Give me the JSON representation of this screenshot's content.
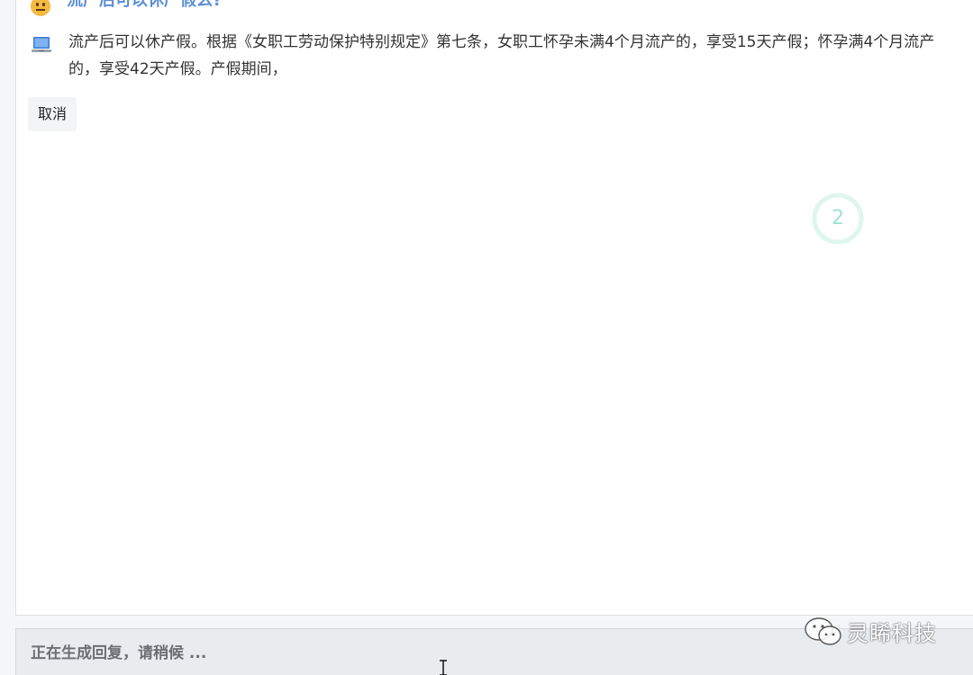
{
  "conversation": {
    "user_question": "流产后可以休产假么?",
    "bot_answer": "流产后可以休产假。根据《女职工劳动保护特别规定》第七条，女职工怀孕未满4个月流产的，享受15天产假；怀孕满4个月流产的，享受42天产假。产假期间，"
  },
  "actions": {
    "cancel_label": "取消"
  },
  "progress": {
    "step": "2"
  },
  "status": {
    "text": "正在生成回复，请稍候 ..."
  },
  "watermark": {
    "text": "灵睎科技"
  },
  "icons": {
    "user_avatar": "slightly-frowning-face-icon",
    "bot_avatar": "laptop-icon",
    "watermark_logo": "wechat-icon",
    "cursor": "text-cursor-icon"
  },
  "colors": {
    "question": "#5b8fd6",
    "progress": "#9fe2d2",
    "status_bg": "#e9ecef"
  }
}
